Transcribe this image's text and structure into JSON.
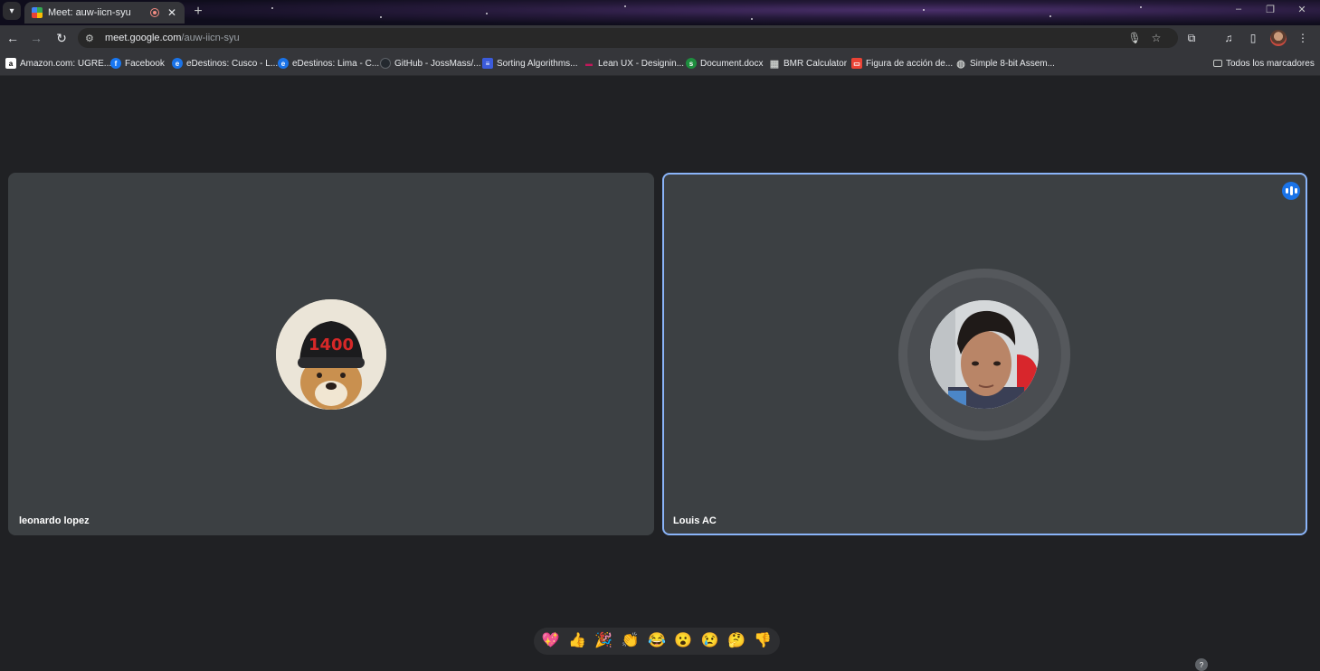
{
  "browser": {
    "tab": {
      "title": "Meet: auw-iicn-syu",
      "close": "✕"
    },
    "new_tab": "+",
    "window_controls": [
      "–",
      "❐",
      "✕"
    ],
    "url": {
      "host": "meet.google.com",
      "path": "/auw-iicn-syu"
    },
    "bookmarks": [
      {
        "label": "Amazon.com: UGRE...",
        "icon": "amazon-icon",
        "color": "#ffffff",
        "glyph": "a"
      },
      {
        "label": "Facebook",
        "icon": "facebook-icon",
        "color": "#1877f2",
        "glyph": "f"
      },
      {
        "label": "eDestinos: Cusco - L...",
        "icon": "edestinos-icon",
        "color": "#1a73e8",
        "glyph": "e"
      },
      {
        "label": "eDestinos: Lima - C...",
        "icon": "edestinos-icon",
        "color": "#1a73e8",
        "glyph": "e"
      },
      {
        "label": "GitHub - JossMass/...",
        "icon": "github-icon",
        "color": "#24292f",
        "glyph": ""
      },
      {
        "label": "Sorting Algorithms...",
        "icon": "sorting-icon",
        "color": "#3b5bdb",
        "glyph": "≡"
      },
      {
        "label": "Lean UX - Designin...",
        "icon": "leanux-icon",
        "color": "#c2185b",
        "glyph": "▬"
      },
      {
        "label": "Document.docx",
        "icon": "document-icon",
        "color": "#1e8e3e",
        "glyph": "s"
      },
      {
        "label": "BMR Calculator",
        "icon": "calculator-icon",
        "color": "#9aa0a6",
        "glyph": "▦"
      },
      {
        "label": "Figura de acción de...",
        "icon": "figure-icon",
        "color": "#ea4335",
        "glyph": "▭"
      },
      {
        "label": "Simple 8-bit Assem...",
        "icon": "globe-icon",
        "color": "#9aa0a6",
        "glyph": "◍"
      }
    ],
    "all_bookmarks": "Todos los marcadores"
  },
  "meet": {
    "participants": [
      {
        "name": "leonardo lopez"
      },
      {
        "name": "Louis AC",
        "speaking": true
      }
    ],
    "reactions": [
      "💖",
      "👍",
      "🎉",
      "👏",
      "😂",
      "😮",
      "😢",
      "🤔",
      "👎"
    ],
    "help_badge": "?"
  },
  "colors": {
    "speaking_accent": "#8ab4f8",
    "speaking_badge": "#1a73e8",
    "stage_bg": "#202124",
    "tile_bg": "#3c4043"
  }
}
